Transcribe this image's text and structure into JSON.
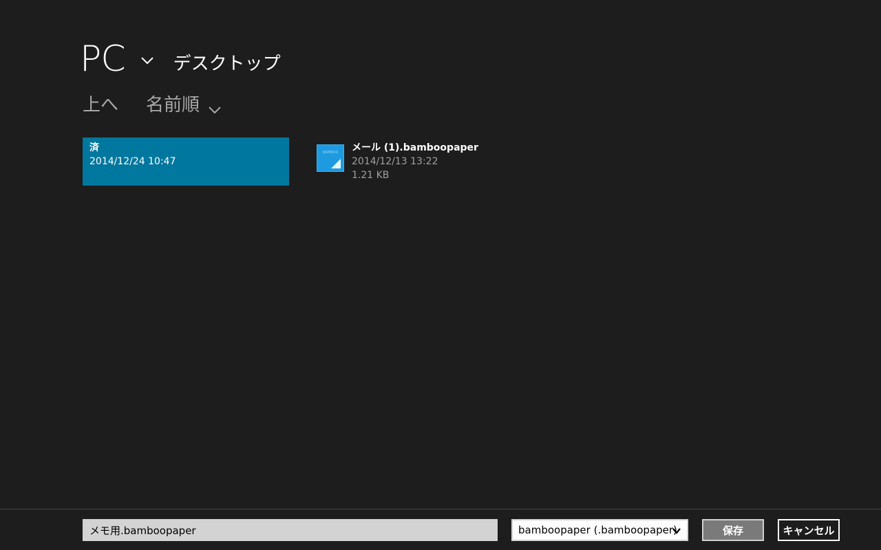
{
  "header": {
    "location": "PC",
    "folder": "デスクトップ"
  },
  "commands": {
    "up_label": "上へ",
    "sort_label": "名前順"
  },
  "items": {
    "folder": {
      "name": "済",
      "date": "2014/12/24 10:47"
    },
    "file": {
      "name": "メール (1).bamboopaper",
      "date": "2014/12/13 13:22",
      "size": "1.21 KB",
      "icon": "bamboo-paper-file-icon"
    }
  },
  "bottom_bar": {
    "filename_value": "メモ用.bamboopaper",
    "file_type": "bamboopaper (.bamboopaper)",
    "save_label": "保存",
    "cancel_label": "キャンセル"
  },
  "colors": {
    "background": "#1d1d1d",
    "selected_tile": "#00779e",
    "file_thumb": "#1e9be0"
  }
}
